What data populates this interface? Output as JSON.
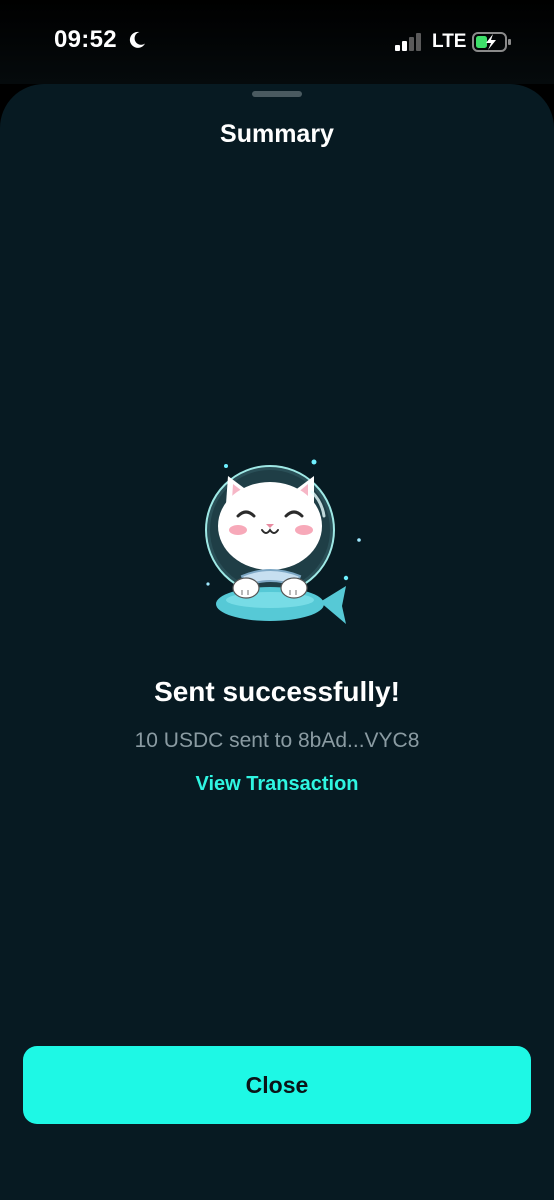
{
  "status_bar": {
    "time": "09:52",
    "network": "LTE",
    "icons": [
      "moon-icon",
      "signal-icon",
      "battery-charging-icon"
    ]
  },
  "sheet": {
    "title": "Summary",
    "illustration": "astronaut-cat-mascot"
  },
  "result": {
    "title": "Sent successfully!",
    "subtitle": "10 USDC sent to 8bAd...VYC8",
    "link_label": "View Transaction"
  },
  "footer": {
    "close_label": "Close"
  },
  "colors": {
    "sheet_background": "#071a22",
    "accent": "#1ef8e5",
    "link": "#2ff5e1",
    "muted_text": "#8a9ba2"
  }
}
